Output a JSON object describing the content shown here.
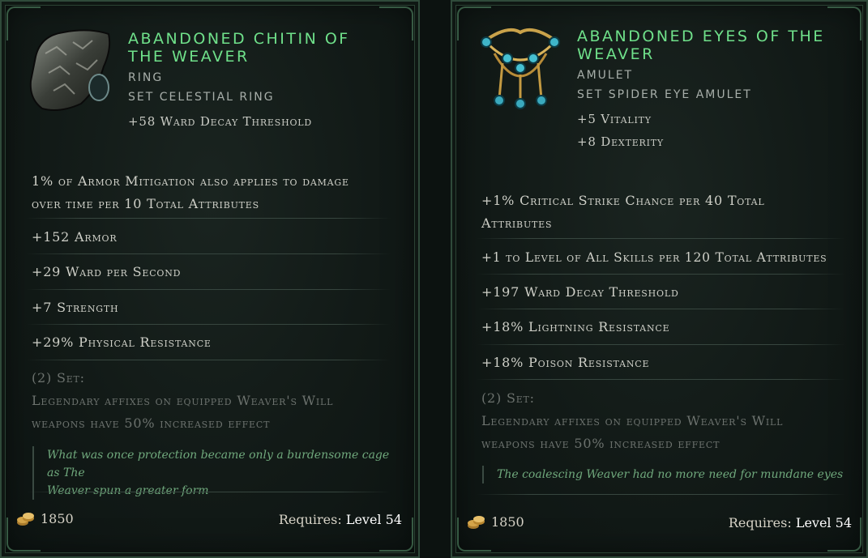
{
  "left": {
    "name_line1": "ABANDONED CHITIN OF",
    "name_line2": "THE WEAVER",
    "type": "RING",
    "base": "SET CELESTIAL RING",
    "implicits": [
      "+58 Ward Decay Threshold"
    ],
    "affixes": [
      "1% of Armor Mitigation also applies to damage",
      "over time per 10 Total Attributes",
      "+152 Armor",
      "+29 Ward per Second",
      "+7 Strength",
      "+29% Physical Resistance"
    ],
    "set_header": "(2) Set:",
    "set_line1": "Legendary affixes on equipped Weaver's Will",
    "set_line2": "weapons have 50% increased effect",
    "lore_line1": "What was once protection became only a burdensome cage as The",
    "lore_line2": "Weaver spun a greater form",
    "gold": "1850",
    "requires_label": "Requires:",
    "requires_level": "Level 54",
    "icon": "ring-icon"
  },
  "right": {
    "name_line1": "ABANDONED EYES OF THE",
    "name_line2": "WEAVER",
    "type": "AMULET",
    "base": "SET SPIDER EYE AMULET",
    "implicits": [
      "+5 Vitality",
      "+8 Dexterity"
    ],
    "affixes": [
      "+1% Critical Strike Chance per 40 Total",
      "Attributes",
      "+1 to Level of All Skills per 120 Total Attributes",
      "+197 Ward Decay Threshold",
      "+18% Lightning Resistance",
      "+18% Poison Resistance"
    ],
    "set_header": "(2) Set:",
    "set_line1": "Legendary affixes on equipped Weaver's Will",
    "set_line2": "weapons have 50% increased effect",
    "lore_line1": "The coalescing Weaver had no more need for mundane eyes",
    "gold": "1850",
    "requires_label": "Requires:",
    "requires_level": "Level 54",
    "icon": "amulet-icon"
  },
  "colors": {
    "name": "#6fe08a",
    "lore": "#6fa87c",
    "set_text": "#6c726e",
    "border": "#2f4a3a"
  }
}
